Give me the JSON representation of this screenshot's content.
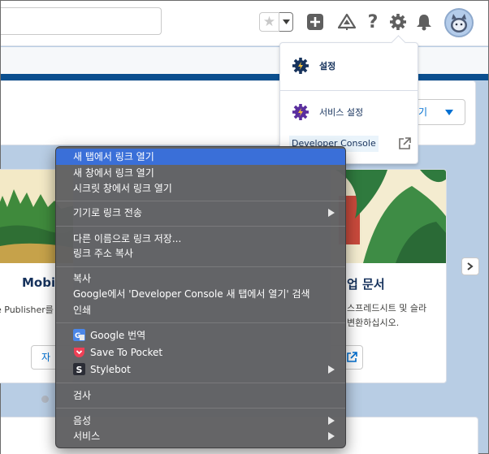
{
  "header": {
    "search_value": "",
    "icons": [
      "star-icon",
      "chevron-down-icon",
      "add-icon",
      "trailhead-icon",
      "help-icon",
      "gear-icon",
      "bell-icon",
      "avatar"
    ]
  },
  "main": {
    "open_button_label": "들기",
    "cards": [
      {
        "title": "Mobi",
        "desc_line1": "e Publisher를",
        "desc_line2": "",
        "button_label": "자"
      },
      {
        "title": "업 문서",
        "desc_line1": "스프레드시트 및 슬라",
        "desc_line2": "변환하십시오.",
        "button_label": ""
      }
    ]
  },
  "setup_menu": {
    "items": [
      {
        "label": "설정",
        "icon": "setup-gear-icon"
      },
      {
        "label": "서비스 설정",
        "icon": "service-setup-icon"
      }
    ],
    "developer_console": {
      "label": "Developer Console",
      "icon": "external-link-icon"
    }
  },
  "context_menu": {
    "items": [
      {
        "label": "새 탭에서 링크 열기",
        "highlighted": true
      },
      {
        "label": "새 창에서 링크 열기"
      },
      {
        "label": "시크릿 창에서 링크 열기"
      },
      {
        "label": "기기로 링크 전송",
        "submenu": true
      },
      {
        "label": "다른 이름으로 링크 저장..."
      },
      {
        "label": "링크 주소 복사"
      },
      {
        "label": "복사"
      },
      {
        "label": "Google에서 'Developer Console 새 탭에서 열기' 검색"
      },
      {
        "label": "인쇄"
      },
      {
        "label": "Google 번역",
        "icon": "google-translate-icon"
      },
      {
        "label": "Save To Pocket",
        "icon": "pocket-icon"
      },
      {
        "label": "Stylebot",
        "icon": "stylebot-icon",
        "submenu": true
      },
      {
        "label": "검사"
      },
      {
        "label": "음성",
        "submenu": true
      },
      {
        "label": "서비스",
        "submenu": true
      }
    ]
  },
  "colors": {
    "brand_blue": "#0070d2",
    "header_band": "#0b4f8f",
    "setup_icon_blue": "#16325c",
    "service_icon_purple": "#5a2e9e",
    "menu_highlight": "#3a6fd8",
    "pocket_red": "#ef4056"
  }
}
